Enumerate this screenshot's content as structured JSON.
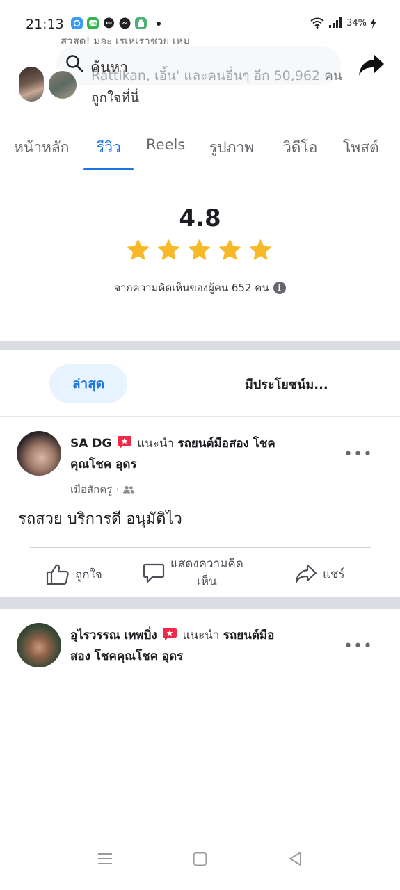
{
  "status_bar": {
    "time": "21:13",
    "battery": "34%",
    "notification_icons": [
      "signal-app-icon",
      "line-app-icon",
      "chat-app-icon",
      "messenger-app-icon",
      "android-app-icon"
    ]
  },
  "header": {
    "ghost_text": "สวสด! มอะ เรเหเราชวย เหม",
    "search_placeholder": "ค้นหา",
    "likers_text_faded": "Rattikan, เอิ้น' และคนอื่นๆ อีก 50,962",
    "likers_text_suffix": "คน",
    "likers_text_line2": "ถูกใจที่นี่"
  },
  "tabs": [
    {
      "label": "หน้าหลัก",
      "active": false
    },
    {
      "label": "รีวิว",
      "active": true
    },
    {
      "label": "Reels",
      "active": false
    },
    {
      "label": "รูปภาพ",
      "active": false
    },
    {
      "label": "วิดีโอ",
      "active": false
    },
    {
      "label": "โพสต์",
      "active": false
    }
  ],
  "rating": {
    "value": "4.8",
    "stars": 5,
    "count_text": "จากความคิดเห็นของผู้คน 652 คน"
  },
  "filters": {
    "latest": "ล่าสุด",
    "helpful": "มีประโยชน์ม..."
  },
  "reviews": [
    {
      "name": "SA DG",
      "recommends": "แนะนำ",
      "page_line1": "รถยนต์มือสอง โชค",
      "page_line2": "คุณโชค อุดร",
      "time": "เมื่อสักครู่",
      "text": "รถสวย บริการดี อนุมัติไว"
    },
    {
      "name": "อุไรวรรณ เทพบิ่ง",
      "recommends": "แนะนำ",
      "page_line1": "รถยนต์มือ",
      "page_line2": "สอง โชคคุณโชค อุดร"
    }
  ],
  "actions": {
    "like": "ถูกใจ",
    "comment_line1": "แสดงความคิด",
    "comment_line2": "เห็น",
    "share": "แชร์"
  },
  "colors": {
    "accent": "#1b74e4",
    "star": "#f7b928",
    "recommend_badge": "#f02849",
    "divider": "#dadde1"
  }
}
